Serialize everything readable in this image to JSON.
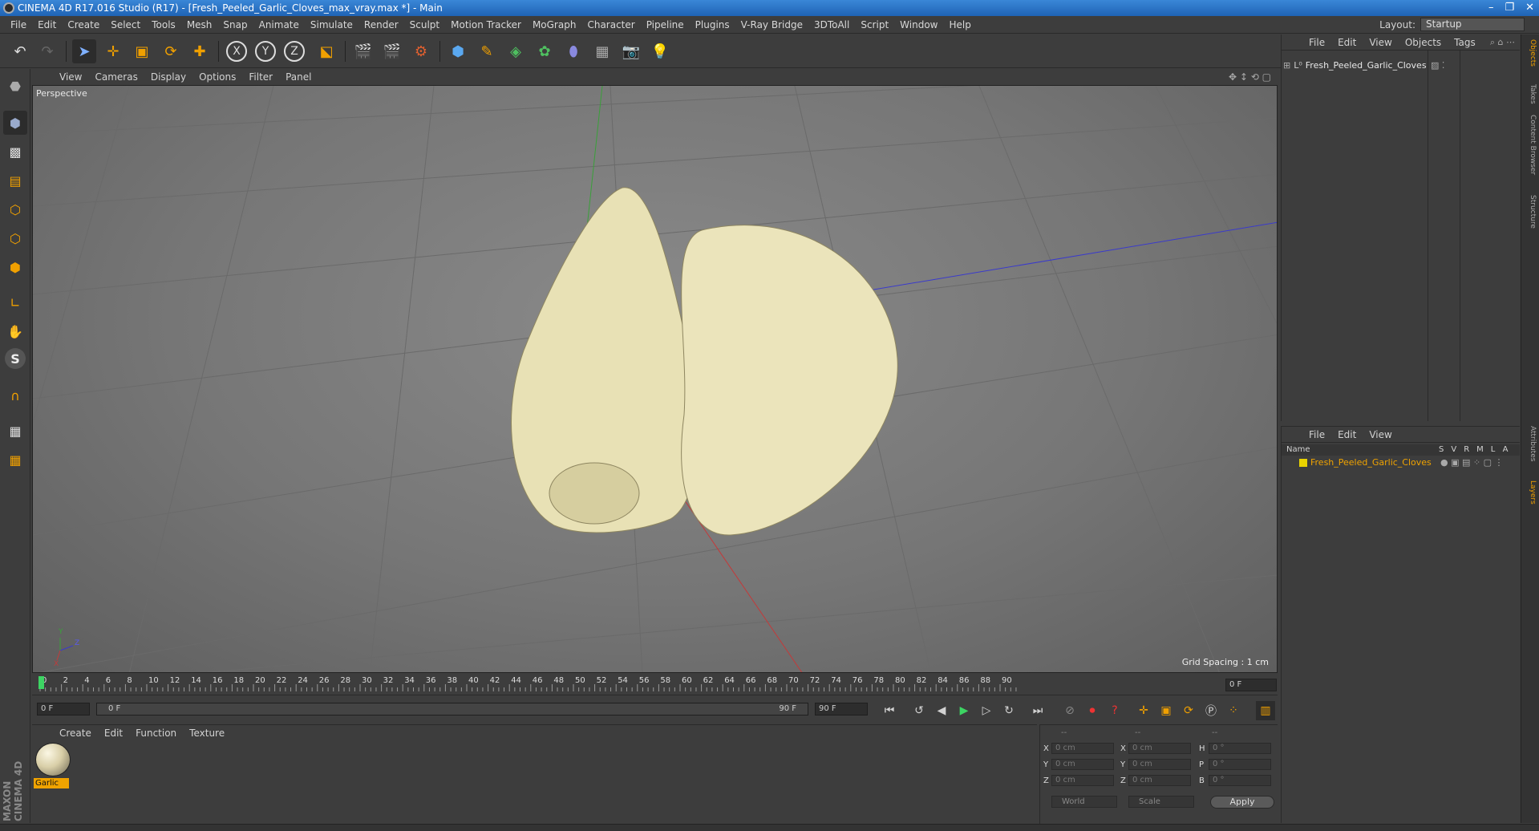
{
  "window": {
    "title": "CINEMA 4D R17.016 Studio (R17) - [Fresh_Peeled_Garlic_Cloves_max_vray.max *] - Main",
    "controls": [
      "–",
      "❐",
      "✕"
    ]
  },
  "menubar": {
    "items": [
      "File",
      "Edit",
      "Create",
      "Select",
      "Tools",
      "Mesh",
      "Snap",
      "Animate",
      "Simulate",
      "Render",
      "Sculpt",
      "Motion Tracker",
      "MoGraph",
      "Character",
      "Pipeline",
      "Plugins",
      "V-Ray Bridge",
      "3DToAll",
      "Script",
      "Window",
      "Help"
    ],
    "layout_label": "Layout:",
    "layout_value": "Startup"
  },
  "viewport": {
    "menu": [
      "View",
      "Cameras",
      "Display",
      "Options",
      "Filter",
      "Panel"
    ],
    "label": "Perspective",
    "grid_spacing": "Grid Spacing : 1 cm",
    "axis_labels": {
      "y": "Y",
      "z": "Z",
      "x": "X"
    },
    "colors": {
      "x_axis": "#c33a3a",
      "y_axis": "#3aa03a",
      "z_axis": "#3a3acc",
      "garlic": "#e9e2b8"
    }
  },
  "timeline": {
    "ticks": [
      "0",
      "2",
      "4",
      "6",
      "8",
      "10",
      "12",
      "14",
      "16",
      "18",
      "20",
      "22",
      "24",
      "26",
      "28",
      "30",
      "32",
      "34",
      "36",
      "38",
      "40",
      "42",
      "44",
      "46",
      "48",
      "50",
      "52",
      "54",
      "56",
      "58",
      "60",
      "62",
      "64",
      "66",
      "68",
      "70",
      "72",
      "74",
      "76",
      "78",
      "80",
      "82",
      "84",
      "86",
      "88",
      "90"
    ],
    "current_frame": "0 F"
  },
  "playback": {
    "start": "0 F",
    "range_start": "0 F",
    "range_end": "90 F",
    "end": "90 F"
  },
  "material_manager": {
    "menu": [
      "Create",
      "Edit",
      "Function",
      "Texture"
    ],
    "material_name": "Garlic"
  },
  "coordinates": {
    "header": [
      "--",
      "--",
      "--"
    ],
    "rows": [
      {
        "a": "X",
        "av": "0 cm",
        "b": "X",
        "bv": "0 cm",
        "c": "H",
        "cv": "0 °"
      },
      {
        "a": "Y",
        "av": "0 cm",
        "b": "Y",
        "bv": "0 cm",
        "c": "P",
        "cv": "0 °"
      },
      {
        "a": "Z",
        "av": "0 cm",
        "b": "Z",
        "bv": "0 cm",
        "c": "B",
        "cv": "0 °"
      }
    ],
    "mode1": "World",
    "mode2": "Scale",
    "apply": "Apply"
  },
  "object_manager": {
    "menu": [
      "File",
      "Edit",
      "View",
      "Objects",
      "Tags"
    ],
    "object_name": "Fresh_Peeled_Garlic_Cloves"
  },
  "layer_manager": {
    "menu": [
      "File",
      "Edit",
      "View"
    ],
    "header_name": "Name",
    "header_flags": [
      "S",
      "V",
      "R",
      "M",
      "L",
      "A"
    ],
    "layer_name": "Fresh_Peeled_Garlic_Cloves"
  },
  "side_tabs": [
    "Objects",
    "Takes",
    "Content Browser",
    "Structure",
    "Attributes",
    "Layers"
  ],
  "brand": "MAXON CINEMA 4D"
}
